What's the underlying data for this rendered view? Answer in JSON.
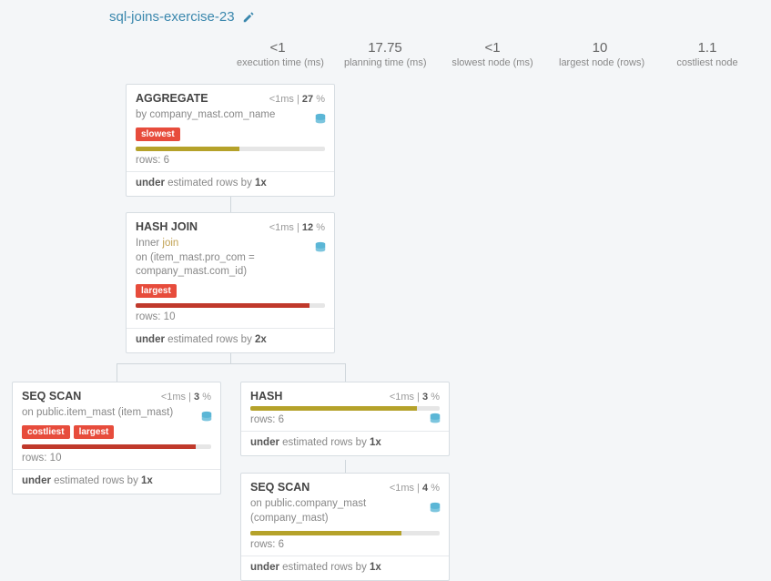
{
  "title": "sql-joins-exercise-23",
  "stats": {
    "exec_val": "<1",
    "exec_lbl": "execution time (ms)",
    "plan_val": "17.75",
    "plan_lbl": "planning time (ms)",
    "slow_val": "<1",
    "slow_lbl": "slowest node (ms)",
    "large_val": "10",
    "large_lbl": "largest node (rows)",
    "cost_val": "1.1",
    "cost_lbl": "costliest node"
  },
  "nodes": {
    "agg": {
      "name": "AGGREGATE",
      "time": "<1",
      "pct": "27",
      "sub_prefix": "by ",
      "sub_main": "company_mast.com_name",
      "tag1": "slowest",
      "rows": "rows: 6",
      "est_pre": "under",
      "est_mid": " estimated rows by ",
      "est_x": "1x"
    },
    "hj": {
      "name": "HASH JOIN",
      "time": "<1",
      "pct": "12",
      "sub_line1a": "Inner ",
      "sub_line1b": "join",
      "sub_line2": "on (item_mast.pro_com = company_mast.com_id)",
      "tag1": "largest",
      "rows": "rows: 10",
      "est_pre": "under",
      "est_mid": " estimated rows by ",
      "est_x": "2x"
    },
    "ss1": {
      "name": "SEQ SCAN",
      "time": "<1",
      "pct": "3",
      "sub_prefix": "on ",
      "sub_main": "public.item_mast (item_mast)",
      "tag1": "costliest",
      "tag2": "largest",
      "rows": "rows: 10",
      "est_pre": "under",
      "est_mid": " estimated rows by ",
      "est_x": "1x"
    },
    "hash": {
      "name": "HASH",
      "time": "<1",
      "pct": "3",
      "rows": "rows: 6",
      "est_pre": "under",
      "est_mid": " estimated rows by ",
      "est_x": "1x"
    },
    "ss2": {
      "name": "SEQ SCAN",
      "time": "<1",
      "pct": "4",
      "sub_prefix": "on ",
      "sub_main": "public.company_mast (company_mast)",
      "rows": "rows: 6",
      "est_pre": "under",
      "est_mid": " estimated rows by ",
      "est_x": "1x"
    }
  }
}
